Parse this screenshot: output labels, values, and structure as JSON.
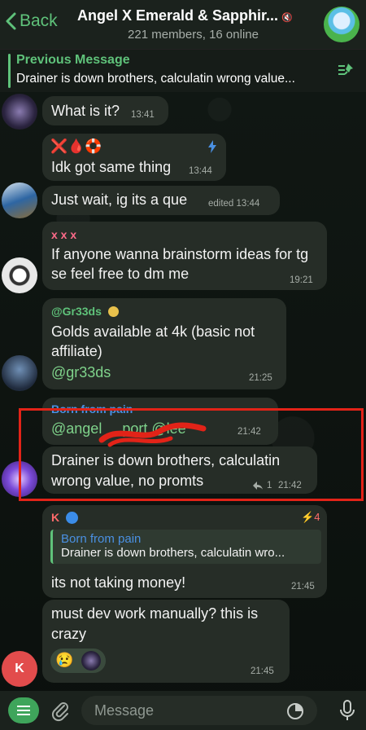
{
  "header": {
    "back_label": "Back",
    "title": "Angel X Emerald & Sapphir...",
    "subtitle": "221 members, 16 online"
  },
  "pinned": {
    "title": "Previous Message",
    "text": "Drainer is down brothers, calculatin wrong value..."
  },
  "messages": [
    {
      "text": "What is it?",
      "time": "13:41"
    },
    {
      "emoji": "❌🩸🛟",
      "text": "Idk got same thing",
      "time": "13:44"
    },
    {
      "text": "Just wait, ig its a que",
      "time": "edited 13:44"
    },
    {
      "sender": "x x x",
      "text": "If anyone wanna brainstorm ideas for tg se feel free to dm me",
      "time": "19:21"
    },
    {
      "sender": "@Gr33ds",
      "text1": "Golds available at 4k (basic not",
      "text2": "affiliate)",
      "mention": "@gr33ds",
      "time": "21:25"
    },
    {
      "sender": "Born from pain",
      "mentions": "@angel     port @lee",
      "time": "21:42"
    },
    {
      "text1": "Drainer is down brothers, calculatin",
      "text2": "wrong value, no promts",
      "replies": "1",
      "time": "21:42"
    },
    {
      "sender": "K",
      "badge_count": "4",
      "reply_sender": "Born from pain",
      "reply_text": "Drainer is down brothers, calculatin wro...",
      "text": "its not taking money!",
      "time": "21:45"
    },
    {
      "text1": "must dev work manually? this is",
      "text2": "crazy",
      "reaction": "😢",
      "time": "21:45"
    }
  ],
  "avatar_letter": "K",
  "input": {
    "placeholder": "Message"
  },
  "colors": {
    "accent": "#5fc27a",
    "bubble": "#262d27",
    "highlight": "#e22318",
    "sender_pink": "#ff6b8a",
    "sender_yellow": "#e8c14c"
  }
}
